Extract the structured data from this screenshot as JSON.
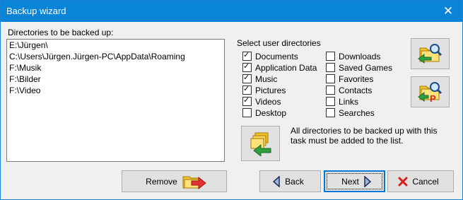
{
  "window": {
    "title": "Backup wizard",
    "close_glyph": "✕"
  },
  "left": {
    "label": "Directories to be backed up:",
    "directories": [
      "E:\\Jürgen\\",
      "C:\\Users\\Jürgen.Jürgen-PC\\AppData\\Roaming",
      "F:\\Musik",
      "F:\\Bilder",
      "F:\\Video"
    ]
  },
  "user_dirs": {
    "label": "Select user directories",
    "col1": [
      {
        "label": "Documents",
        "checked": true
      },
      {
        "label": "Application Data",
        "checked": true
      },
      {
        "label": "Music",
        "checked": true
      },
      {
        "label": "Pictures",
        "checked": true
      },
      {
        "label": "Videos",
        "checked": true
      },
      {
        "label": "Desktop",
        "checked": false
      }
    ],
    "col2": [
      {
        "label": "Downloads",
        "checked": false
      },
      {
        "label": "Saved Games",
        "checked": false
      },
      {
        "label": "Favorites",
        "checked": false
      },
      {
        "label": "Contacts",
        "checked": false
      },
      {
        "label": "Links",
        "checked": false
      },
      {
        "label": "Searches",
        "checked": false
      }
    ]
  },
  "info_text": "All directories to be backed up with this task must be added to the list.",
  "buttons": {
    "remove": "Remove",
    "back": "Back",
    "next": "Next",
    "cancel": "Cancel"
  },
  "icons": {
    "browse": "folder-search-icon",
    "browse_special": "folder-search-p-icon",
    "add": "folder-add-icon",
    "remove": "folder-remove-icon",
    "back": "back-arrow-icon",
    "next": "next-arrow-icon",
    "cancel": "cancel-x-icon"
  },
  "colors": {
    "titlebar": "#0a84d6",
    "accent": "#0078d7"
  }
}
